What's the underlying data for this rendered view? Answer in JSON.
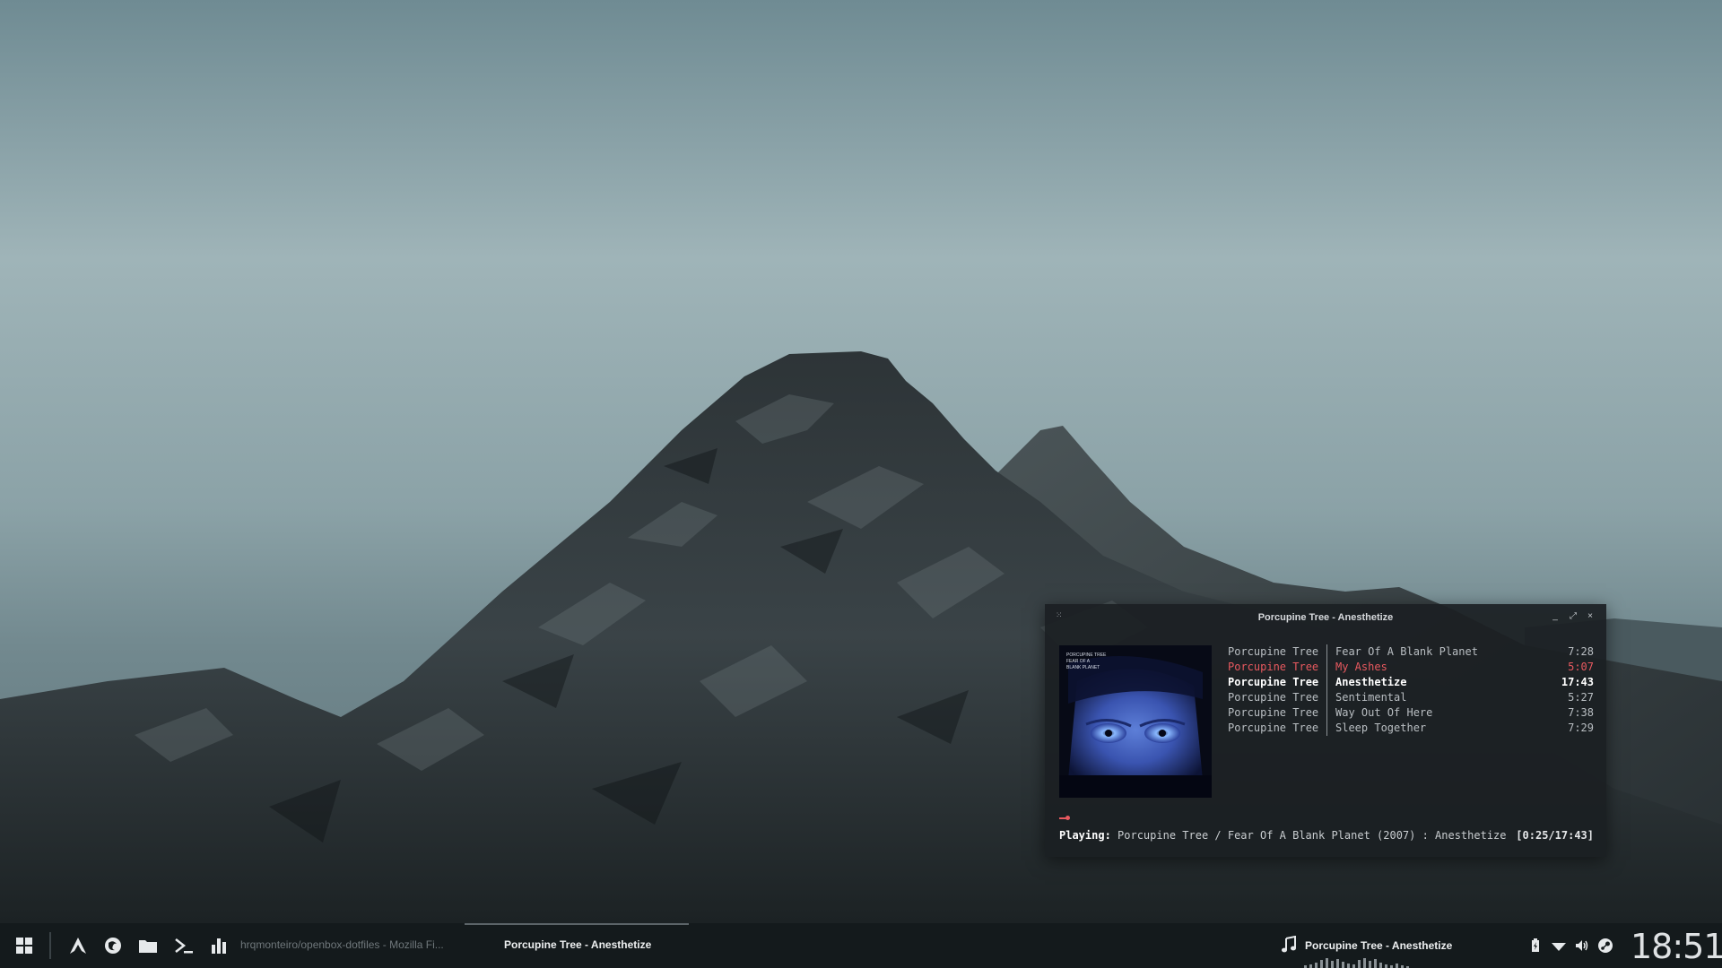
{
  "desktop": {
    "wallpaper": "mountain-landscape"
  },
  "player": {
    "window_title": "Porcupine Tree - Anesthetize",
    "album_art": "album-cover-fear-of-a-blank-planet",
    "album_cover_text": "PORCUPINE TREE FEAR OF A BLANK PLANET",
    "playlist": [
      {
        "artist": "Porcupine Tree",
        "title": "Fear Of A Blank Planet",
        "duration": "7:28",
        "state": "normal"
      },
      {
        "artist": "Porcupine Tree",
        "title": "My Ashes",
        "duration": "5:07",
        "state": "selected"
      },
      {
        "artist": "Porcupine Tree",
        "title": "Anesthetize",
        "duration": "17:43",
        "state": "playing"
      },
      {
        "artist": "Porcupine Tree",
        "title": "Sentimental",
        "duration": "5:27",
        "state": "normal"
      },
      {
        "artist": "Porcupine Tree",
        "title": "Way Out Of Here",
        "duration": "7:38",
        "state": "normal"
      },
      {
        "artist": "Porcupine Tree",
        "title": "Sleep Together",
        "duration": "7:29",
        "state": "normal"
      }
    ],
    "status_label": "Playing:",
    "status_text": "Porcupine Tree / Fear Of A Blank Planet (2007) : Anesthetize",
    "status_time": "[0:25/17:43]",
    "progress_fraction": 0.024,
    "colors": {
      "accent": "#e8595f",
      "background": "#1b1f22"
    }
  },
  "taskbar": {
    "launchers": [
      "grid-icon",
      "arch-logo-icon",
      "firefox-icon",
      "folder-icon",
      "terminal-icon",
      "bar-chart-icon"
    ],
    "tasks": [
      {
        "label": "hrqmonteiro/openbox-dotfiles - Mozilla Fi...",
        "active": false
      },
      {
        "label": "Porcupine Tree - Anesthetize",
        "active": true
      }
    ],
    "now_playing": "Porcupine Tree - Anesthetize",
    "tray": [
      "battery-charging-icon",
      "wifi-icon",
      "volume-icon",
      "steam-icon"
    ],
    "clock": "18:51"
  }
}
